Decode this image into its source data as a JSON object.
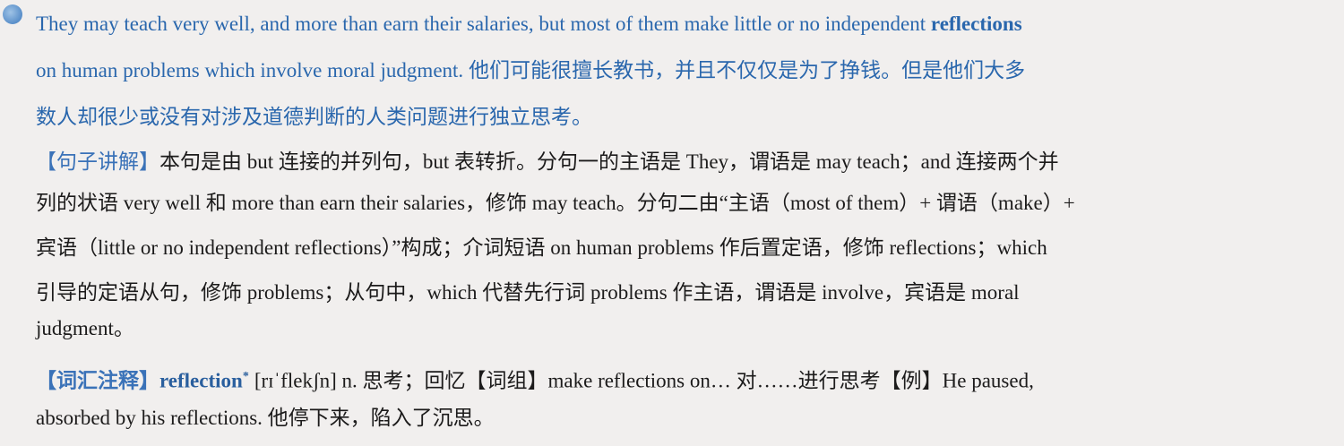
{
  "sentence": {
    "en_part1": "They may teach very well, and more than earn their salaries, but most of them make little or no independent ",
    "en_keyword": "reflections",
    "en_part2": "on human problems which involve moral judgment.",
    "zh_part1": "他们可能很擅长教书，并且不仅仅是为了挣钱。但是他们大多",
    "zh_part2": "数人却很少或没有对涉及道德判断的人类问题进行独立思考。"
  },
  "analysis": {
    "label": "【句子讲解】",
    "line1": "本句是由 but 连接的并列句，but 表转折。分句一的主语是 They，谓语是 may teach；and 连接两个并",
    "line2": "列的状语 very well 和 more than earn their salaries，修饰 may teach。分句二由“主语（most of them）+ 谓语（make）+",
    "line3": "宾语（little or no independent reflections）”构成；介词短语 on human problems 作后置定语，修饰 reflections；which",
    "line4": "引导的定语从句，修饰 problems；从句中，which 代替先行词 problems 作主语，谓语是 involve，宾语是 moral",
    "line5": "judgment。"
  },
  "vocab": {
    "label": "【词汇注释】",
    "headword": "reflection",
    "star": "*",
    "line1_rest": "[rɪˈflekʃn] n. 思考；回忆【词组】make reflections on… 对……进行思考【例】He paused,",
    "line2": "absorbed by his reflections. 他停下来，陷入了沉思。"
  }
}
